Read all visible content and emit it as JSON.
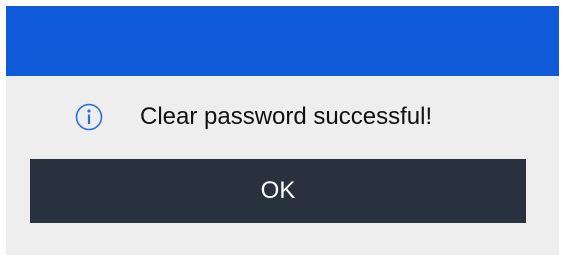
{
  "dialog": {
    "icon": "info-icon",
    "message": "Clear password successful!",
    "ok_label": "OK"
  },
  "colors": {
    "titlebar": "#0f5ad8",
    "dialog_background": "#eeeeee",
    "button_background": "#28323f",
    "button_text": "#ffffff",
    "icon": "#2b6fd6"
  }
}
